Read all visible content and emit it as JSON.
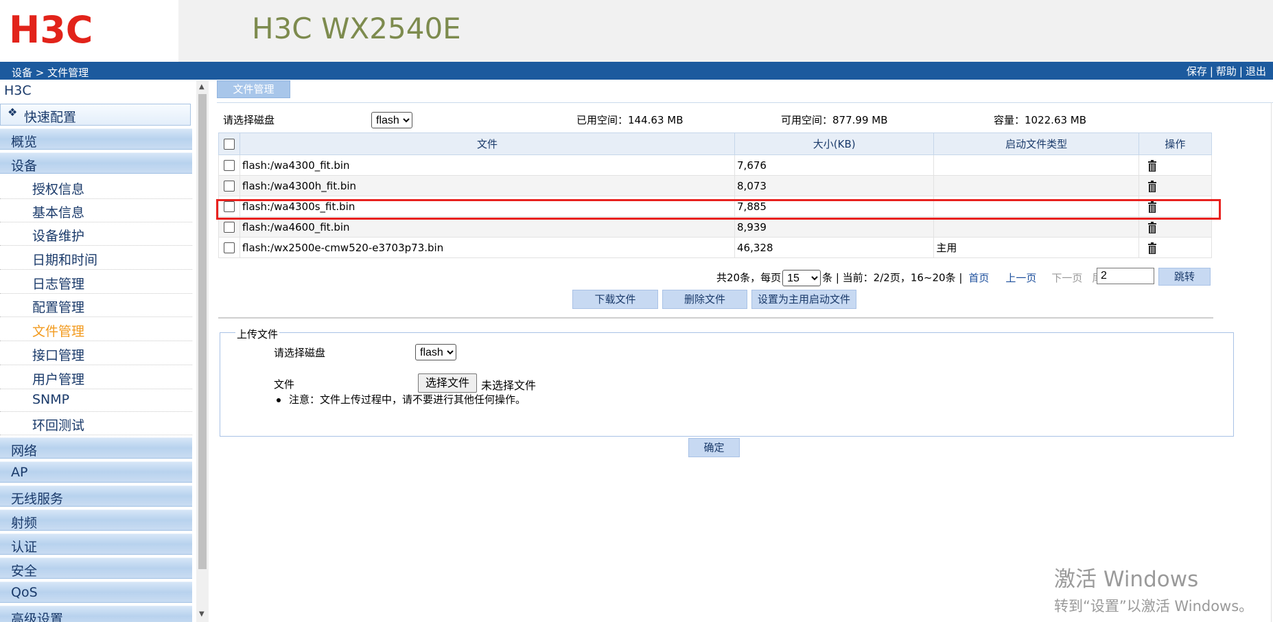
{
  "header": {
    "logo_text": "H3C",
    "product_name": "H3C WX2540E"
  },
  "topbar": {
    "breadcrumb": "设备 > 文件管理",
    "links": [
      "保存",
      "帮助",
      "退出"
    ]
  },
  "sidebar": {
    "root": "H3C",
    "quick_config": "快速配置",
    "categories": {
      "overview": "概览",
      "device": "设备",
      "network": "网络",
      "ap": "AP",
      "wireless": "无线服务",
      "rf": "射频",
      "auth": "认证",
      "security": "安全",
      "qos": "QoS",
      "advanced": "高级设置"
    },
    "device_items": [
      "授权信息",
      "基本信息",
      "设备维护",
      "日期和时间",
      "日志管理",
      "配置管理",
      "文件管理",
      "接口管理",
      "用户管理",
      "SNMP",
      "环回测试"
    ],
    "active_item": "文件管理"
  },
  "tab": {
    "label": "文件管理"
  },
  "disk": {
    "label": "请选择磁盘",
    "selected": "flash",
    "used": "已用空间：144.63 MB",
    "available": "可用空间：877.99 MB",
    "capacity": "容量：1022.63 MB"
  },
  "table": {
    "headers": [
      "文件",
      "大小(KB)",
      "启动文件类型",
      "操作"
    ],
    "rows": [
      {
        "file": "flash:/wa4300_fit.bin",
        "size": "7,676",
        "boot_type": ""
      },
      {
        "file": "flash:/wa4300h_fit.bin",
        "size": "8,073",
        "boot_type": ""
      },
      {
        "file": "flash:/wa4300s_fit.bin",
        "size": "7,885",
        "boot_type": ""
      },
      {
        "file": "flash:/wa4600_fit.bin",
        "size": "8,939",
        "boot_type": ""
      },
      {
        "file": "flash:/wx2500e-cmw520-e3703p73.bin",
        "size": "46,328",
        "boot_type": "主用"
      }
    ]
  },
  "pager": {
    "total": "共20条，每页",
    "per_page": "15",
    "status": "条 | 当前：2/2页，16~20条 |",
    "first": "首页",
    "prev": "上一页",
    "next": "下一页",
    "last": "尾页",
    "page_input": "2",
    "jump": "跳转"
  },
  "actions": {
    "download": "下载文件",
    "delete": "删除文件",
    "set_main": "设置为主用启动文件"
  },
  "upload": {
    "legend": "上传文件",
    "disk_label": "请选择磁盘",
    "disk_selected": "flash",
    "file_label": "文件",
    "choose_button": "选择文件",
    "no_file": "未选择文件",
    "note": "注意：文件上传过程中，请不要进行其他任何操作。",
    "ok": "确定"
  },
  "watermark": {
    "title": "激活 Windows",
    "subtitle": "转到“设置”以激活 Windows。"
  },
  "colors": {
    "topbar": "#1c5a9e",
    "logo_red": "#e2231a",
    "active_menu": "#f29a1e",
    "highlight_border": "#e8211e"
  }
}
